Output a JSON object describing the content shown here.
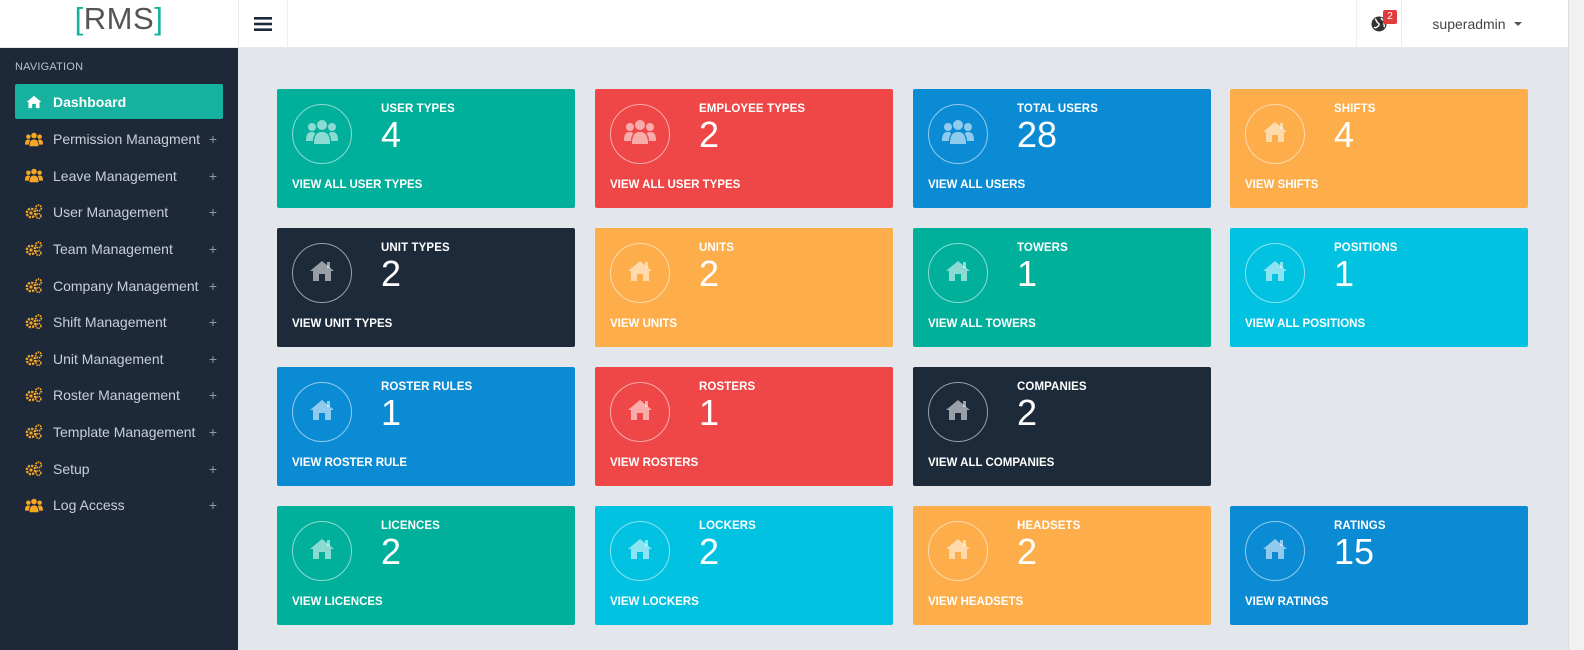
{
  "brand": {
    "open": "[",
    "name": "RMS",
    "close": "]"
  },
  "header": {
    "notification_count": "2",
    "username": "superadmin"
  },
  "sidebar": {
    "title": "NAVIGATION",
    "items": [
      {
        "label": "Dashboard",
        "icon": "home-icon",
        "active": true
      },
      {
        "label": "Permission Managment",
        "icon": "users-icon"
      },
      {
        "label": "Leave Management",
        "icon": "users-icon"
      },
      {
        "label": "User Management",
        "icon": "cogs-icon"
      },
      {
        "label": "Team Management",
        "icon": "cogs-icon"
      },
      {
        "label": "Company Management",
        "icon": "cogs-icon"
      },
      {
        "label": "Shift Management",
        "icon": "cogs-icon"
      },
      {
        "label": "Unit Management",
        "icon": "cogs-icon"
      },
      {
        "label": "Roster Management",
        "icon": "cogs-icon"
      },
      {
        "label": "Template Management",
        "icon": "cogs-icon"
      },
      {
        "label": "Setup",
        "icon": "cogs-icon"
      },
      {
        "label": "Log Access",
        "icon": "users-icon"
      }
    ],
    "expand_symbol": "+"
  },
  "colors": {
    "teal": "#00b09b",
    "red": "#ef4747",
    "blue": "#0b8bd4",
    "orange": "#fdad4a",
    "navy": "#1c2a3a",
    "cyan": "#02c2e2"
  },
  "cards": [
    {
      "label": "USER TYPES",
      "count": "4",
      "link": "VIEW ALL USER TYPES",
      "color": "teal",
      "icon": "users-icon"
    },
    {
      "label": "EMPLOYEE TYPES",
      "count": "2",
      "link": "VIEW ALL USER TYPES",
      "color": "red",
      "icon": "users-icon"
    },
    {
      "label": "TOTAL USERS",
      "count": "28",
      "link": "VIEW ALL USERS",
      "color": "blue",
      "icon": "users-icon"
    },
    {
      "label": "SHIFTS",
      "count": "4",
      "link": "VIEW SHIFTS",
      "color": "orange",
      "icon": "home-icon"
    },
    {
      "label": "UNIT TYPES",
      "count": "2",
      "link": "VIEW UNIT TYPES",
      "color": "navy",
      "icon": "home-icon"
    },
    {
      "label": "UNITS",
      "count": "2",
      "link": "VIEW UNITS",
      "color": "orange",
      "icon": "home-icon"
    },
    {
      "label": "TOWERS",
      "count": "1",
      "link": "VIEW ALL TOWERS",
      "color": "teal",
      "icon": "home-icon"
    },
    {
      "label": "POSITIONS",
      "count": "1",
      "link": "VIEW ALL POSITIONS",
      "color": "cyan",
      "icon": "home-icon"
    },
    {
      "label": "ROSTER RULES",
      "count": "1",
      "link": "VIEW ROSTER RULE",
      "color": "blue",
      "icon": "home-icon"
    },
    {
      "label": "ROSTERS",
      "count": "1",
      "link": "VIEW ROSTERS",
      "color": "red",
      "icon": "home-icon"
    },
    {
      "label": "COMPANIES",
      "count": "2",
      "link": "VIEW ALL COMPANIES",
      "color": "navy",
      "icon": "home-icon"
    },
    {
      "label": "LICENCES",
      "count": "2",
      "link": "VIEW LICENCES",
      "color": "teal",
      "icon": "home-icon"
    },
    {
      "label": "LOCKERS",
      "count": "2",
      "link": "VIEW LOCKERS",
      "color": "cyan",
      "icon": "home-icon"
    },
    {
      "label": "HEADSETS",
      "count": "2",
      "link": "VIEW HEADSETS",
      "color": "orange",
      "icon": "home-icon"
    },
    {
      "label": "RATINGS",
      "count": "15",
      "link": "VIEW RATINGS",
      "color": "blue",
      "icon": "home-icon"
    }
  ]
}
